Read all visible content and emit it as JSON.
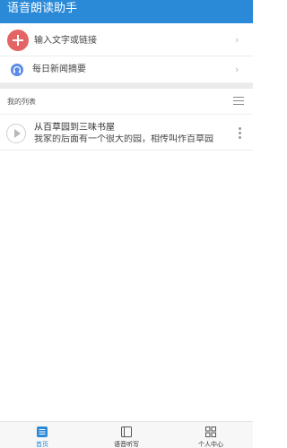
{
  "app": {
    "title": "语音朗读助手"
  },
  "actions": [
    {
      "label": "输入文字或链接",
      "icon": "plus-icon"
    },
    {
      "label": "每日新闻摘要",
      "icon": "headphones-icon"
    }
  ],
  "my_list": {
    "header": "我的列表",
    "items": [
      {
        "title": "从百草园到三味书屋",
        "preview": "我家的后面有一个很大的园，相传叫作百草园"
      }
    ]
  },
  "tabs": [
    {
      "label": "首页",
      "icon": "home-icon",
      "active": true
    },
    {
      "label": "语音听写",
      "icon": "notebook-icon",
      "active": false
    },
    {
      "label": "个人中心",
      "icon": "grid-icon",
      "active": false
    }
  ],
  "colors": {
    "primary": "#2a8ad8",
    "add": "#e36464",
    "headphones": "#5b8be8",
    "band": "#ebebeb"
  }
}
